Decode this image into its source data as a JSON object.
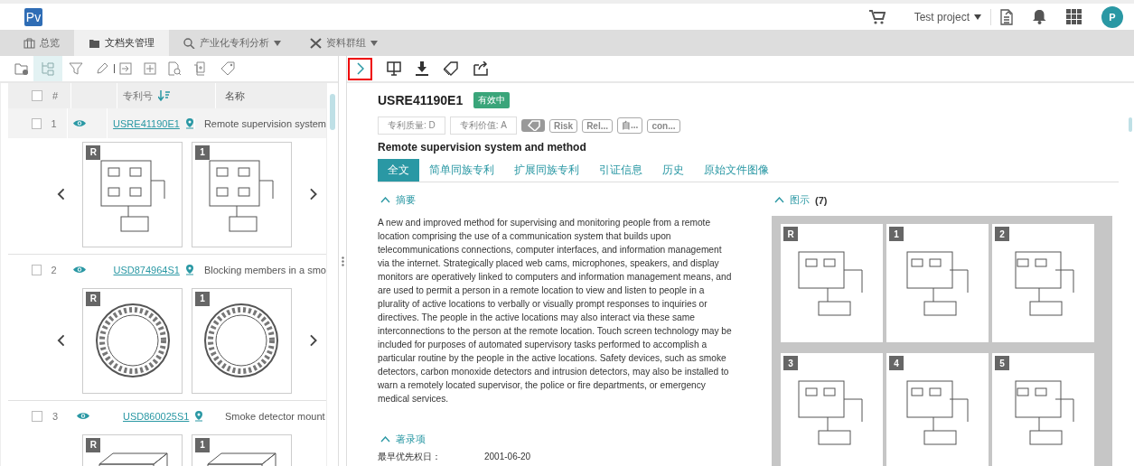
{
  "header": {
    "logo": "Pv",
    "project": "Test project",
    "avatar": "P"
  },
  "nav_tabs": [
    {
      "label": "总览",
      "selected": false,
      "dropdown": false
    },
    {
      "label": "文档夹管理",
      "selected": true,
      "dropdown": false
    },
    {
      "label": "产业化专利分析",
      "selected": false,
      "dropdown": true
    },
    {
      "label": "资料群组",
      "selected": false,
      "dropdown": true
    }
  ],
  "list": {
    "columns": [
      "#",
      "专利号",
      "名称"
    ],
    "all_checked": false,
    "rows": [
      {
        "index": "1",
        "number": "USRE41190E1",
        "title": "Remote supervision system",
        "selected": true,
        "checked": false,
        "images": [
          "R",
          "1"
        ]
      },
      {
        "index": "2",
        "number": "USD874964S1",
        "title": "Blocking members in a smo",
        "selected": false,
        "checked": false,
        "images": [
          "R",
          "1"
        ]
      },
      {
        "index": "3",
        "number": "USD860025S1",
        "title": "Smoke detector mount",
        "selected": false,
        "checked": false,
        "images": [
          "R",
          "1"
        ]
      }
    ]
  },
  "detail": {
    "number": "USRE41190E1",
    "status": "有效中",
    "metrics": [
      "专利质量: D",
      "专利价值: A"
    ],
    "tags": [
      "Risk",
      "Rel...",
      "自...",
      "con..."
    ],
    "title": "Remote supervision system and method",
    "tabs": [
      {
        "label": "全文",
        "selected": true
      },
      {
        "label": "简单同族专利",
        "selected": false
      },
      {
        "label": "扩展同族专利",
        "selected": false
      },
      {
        "label": "引证信息",
        "selected": false
      },
      {
        "label": "历史",
        "selected": false
      },
      {
        "label": "原始文件图像",
        "selected": false
      }
    ],
    "abstract": {
      "heading": "摘要",
      "expanded": true,
      "text": "A new and improved method for supervising and monitoring people from a remote location comprising the use of a communication system that builds upon telecommunications connections, computer interfaces, and information management via the internet. Strategically placed web cams, microphones, speakers, and display monitors are operatively linked to computers and information management means, and are used to permit a person in a remote location to view and listen to people in a plurality of active locations to verbally or visually prompt responses to inquiries or directives. The people in the active locations may also interact via these same interconnections to the person at the remote location. Touch screen technology may be included for purposes of automated supervisory tasks performed to accomplish a particular routine by the people in the active locations. Safety devices, such as smoke detectors, carbon monoxide detectors and intrusion detectors, may also be installed to warn a remotely located supervisor, the police or fire departments, or emergency medical services."
    },
    "figures": {
      "heading": "图示",
      "count": "(7)",
      "expanded": true,
      "labels": [
        "R",
        "1",
        "2",
        "3",
        "4",
        "5"
      ]
    },
    "bibliographic": {
      "heading": "著录项",
      "expanded": true,
      "fields": [
        {
          "label": "最早优先权日：",
          "value": "2001-06-20"
        }
      ]
    }
  }
}
